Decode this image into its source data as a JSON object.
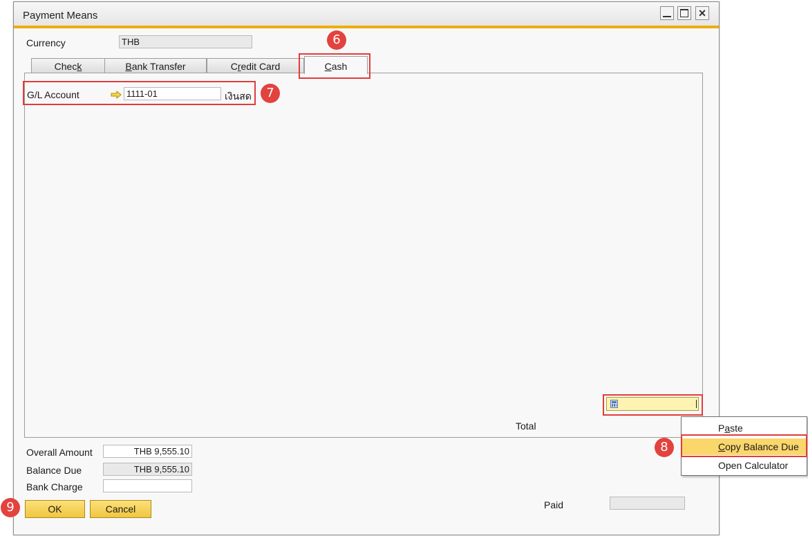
{
  "window": {
    "title": "Payment Means"
  },
  "currency": {
    "label": "Currency",
    "value": "THB"
  },
  "tabs": [
    {
      "pre": "Chec",
      "ul": "k",
      "post": ""
    },
    {
      "pre": "",
      "ul": "B",
      "post": "ank Transfer"
    },
    {
      "pre": "C",
      "ul": "r",
      "post": "edit Card"
    },
    {
      "pre": "",
      "ul": "C",
      "post": "ash"
    }
  ],
  "cash_tab": {
    "gl_label": "G/L Account",
    "gl_value": "1111-01",
    "gl_name": "เงินสด",
    "total_label": "Total"
  },
  "summary": {
    "overall_label": "Overall Amount",
    "overall_value": "THB 9,555.10",
    "balance_label": "Balance Due",
    "balance_value": "THB 9,555.10",
    "bank_charge_label": "Bank Charge",
    "bank_charge_value": "",
    "paid_label": "Paid",
    "paid_value": ""
  },
  "buttons": {
    "ok": "OK",
    "cancel": "Cancel"
  },
  "context_menu": [
    {
      "pre": "P",
      "ul": "a",
      "post": "ste"
    },
    {
      "pre": "",
      "ul": "C",
      "post": "opy Balance Due"
    },
    {
      "pre": "Open Calculator",
      "ul": "",
      "post": ""
    }
  ],
  "badges": {
    "b6": "6",
    "b7": "7",
    "b8": "8",
    "b9": "9"
  },
  "colors": {
    "accent": "#f0ad00",
    "highlight": "#fad66b",
    "annotation": "#e2433f"
  }
}
